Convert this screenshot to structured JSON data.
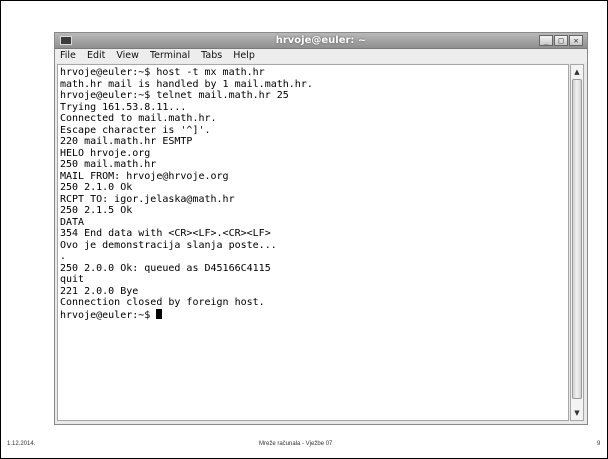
{
  "window": {
    "title": "hrvoje@euler: ~",
    "buttons": {
      "minimize": "_",
      "maximize": "□",
      "close": "✕"
    }
  },
  "menu": [
    {
      "label": "File"
    },
    {
      "label": "Edit"
    },
    {
      "label": "View"
    },
    {
      "label": "Terminal"
    },
    {
      "label": "Tabs"
    },
    {
      "label": "Help"
    }
  ],
  "terminal": {
    "lines": [
      "hrvoje@euler:~$ host -t mx math.hr",
      "math.hr mail is handled by 1 mail.math.hr.",
      "hrvoje@euler:~$ telnet mail.math.hr 25",
      "Trying 161.53.8.11...",
      "Connected to mail.math.hr.",
      "Escape character is '^]'.",
      "220 mail.math.hr ESMTP",
      "HELO hrvoje.org",
      "250 mail.math.hr",
      "MAIL FROM: hrvoje@hrvoje.org",
      "250 2.1.0 Ok",
      "RCPT TO: igor.jelaska@math.hr",
      "250 2.1.5 Ok",
      "DATA",
      "354 End data with <CR><LF>.<CR><LF>",
      "Ovo je demonstracija slanja poste...",
      "",
      ".",
      "250 2.0.0 Ok: queued as D45166C4115",
      "quit",
      "221 2.0.0 Bye",
      "Connection closed by foreign host."
    ],
    "prompt": "hrvoje@euler:~$ "
  },
  "scrollbar": {
    "up": "▲",
    "down": "▼"
  },
  "footer": {
    "date": "1.12.2014.",
    "center": "Mreže računala - Vježbe 07",
    "page": "9"
  }
}
